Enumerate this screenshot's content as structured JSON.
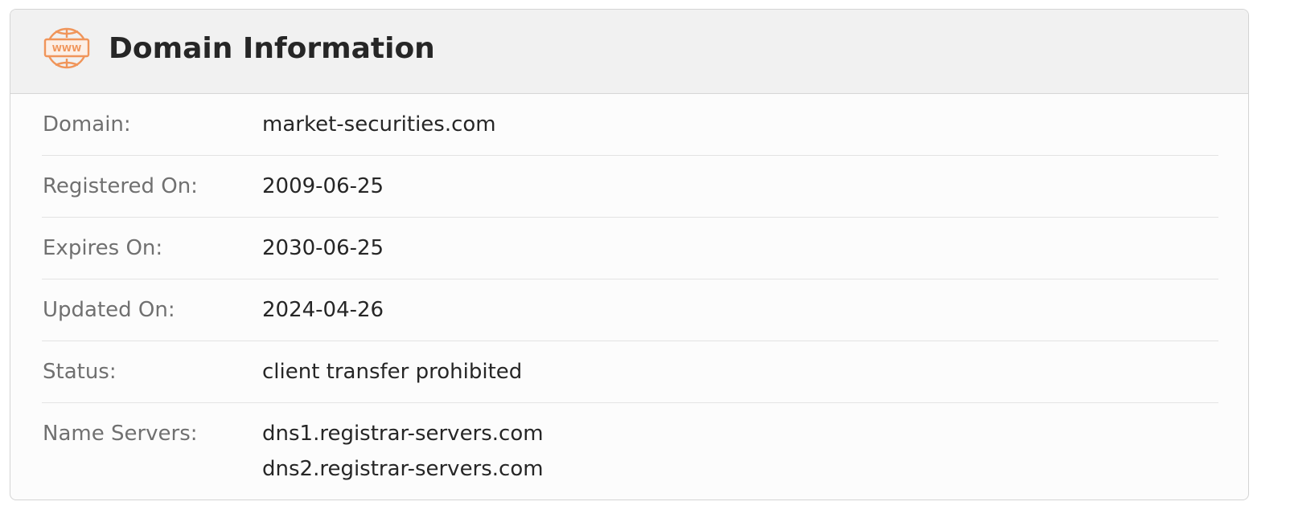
{
  "header": {
    "title": "Domain Information",
    "icon": "www-globe-icon",
    "icon_color": "#f0955a"
  },
  "rows": [
    {
      "label": "Domain:",
      "value": "market-securities.com"
    },
    {
      "label": "Registered On:",
      "value": "2009-06-25"
    },
    {
      "label": "Expires On:",
      "value": "2030-06-25"
    },
    {
      "label": "Updated On:",
      "value": "2024-04-26"
    },
    {
      "label": "Status:",
      "value": "client transfer prohibited"
    },
    {
      "label": "Name Servers:",
      "values": [
        "dns1.registrar-servers.com",
        "dns2.registrar-servers.com"
      ]
    }
  ]
}
